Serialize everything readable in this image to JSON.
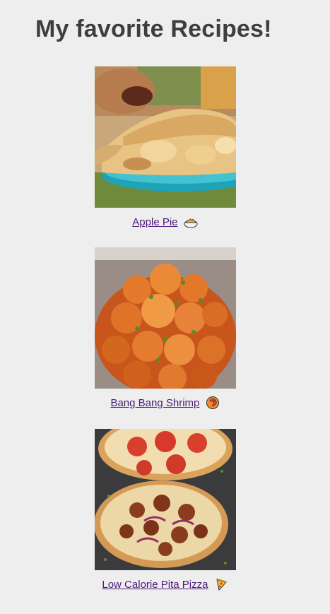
{
  "page": {
    "title": "My favorite Recipes!"
  },
  "recipes": [
    {
      "name": "Apple Pie",
      "emoji": "pie-icon",
      "photo": "apple-pie-photo"
    },
    {
      "name": "Bang Bang Shrimp",
      "emoji": "shrimp-icon",
      "photo": "bang-bang-shrimp-photo"
    },
    {
      "name": "Low Calorie Pita Pizza",
      "emoji": "pizza-icon",
      "photo": "pita-pizza-photo"
    }
  ],
  "colors": {
    "background": "#eeeeee",
    "heading": "#3e3e3e",
    "link": "#4b1a79"
  }
}
